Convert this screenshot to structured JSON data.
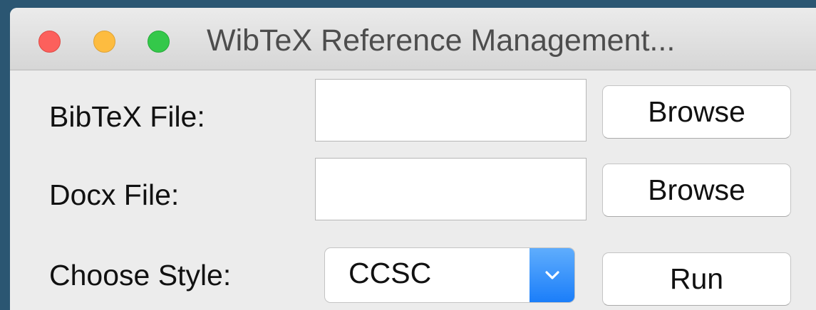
{
  "window": {
    "title": "WibTeX Reference Management..."
  },
  "form": {
    "bibtex_label": "BibTeX File:",
    "bibtex_value": "",
    "bibtex_browse_label": "Browse",
    "docx_label": "Docx File:",
    "docx_value": "",
    "docx_browse_label": "Browse",
    "style_label": "Choose Style:",
    "style_selected": "CCSC",
    "run_label": "Run"
  },
  "icons": {
    "close": "close-icon",
    "minimize": "minimize-icon",
    "maximize": "maximize-icon",
    "dropdown": "chevron-down-icon"
  },
  "colors": {
    "close": "#fc605c",
    "minimize": "#fdbc40",
    "maximize": "#34c84a",
    "accent": "#1b7ef9",
    "desktop": "#2b5672"
  }
}
